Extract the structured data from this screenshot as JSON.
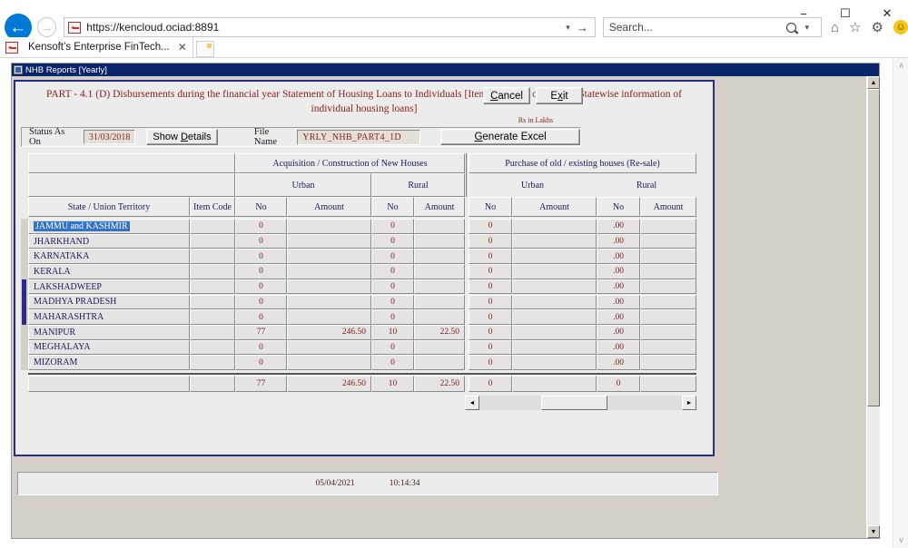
{
  "browser": {
    "url": "https://kencloud.ociad:8891",
    "search_placeholder": "Search...",
    "tab_label": "Kensoft’s Enterprise FinTech...",
    "tab_close": "✕",
    "back_icon": "←",
    "forward_icon": "→",
    "url_dropdown_icon": "▾",
    "url_go_icon": "→",
    "search_dropdown_icon": "▾",
    "home_icon": "⌂",
    "favorites_icon": "☆",
    "settings_icon": "⚙",
    "smiley_icon": "☺",
    "minimize": "−",
    "maximize": "☐",
    "close": "✕",
    "scroll_up_icon": "∧",
    "scroll_down_icon": "∨"
  },
  "window": {
    "title": "NHB Reports [Yearly]",
    "scroll_up_icon": "▲",
    "scroll_down_icon": "▼"
  },
  "report": {
    "title_line1": "PART - 4.1 (D) Disbursements during the financial year Statement of Housing Loans to Individuals [Item Code 411 of",
    "title_line2": "Part-4] [Statewise information of individual housing loans]",
    "cancel_label": "Cancel",
    "exit_label": "Exit",
    "units_note": "Rs in Lakhs"
  },
  "statusbar": {
    "status_label": "Status As On",
    "status_value": "31/03/2018",
    "show_details_label": "Show Details",
    "file_name_label": "File Name",
    "file_name_value": "YRLY_NHB_PART4_1D",
    "generate_excel_label": "Generate Excel"
  },
  "grid": {
    "group_headers": [
      "Acquisition  / Construction of New Houses",
      "Purchase of old / existing houses (Re-sale)"
    ],
    "sub_headers_left": [
      "Urban",
      "Rural"
    ],
    "sub_headers_right": [
      "Urban",
      "Rural"
    ],
    "columns": [
      "State / Union Territory",
      "Item Code",
      "No",
      "Amount",
      "No",
      "Amount",
      "No",
      "Amount",
      "No",
      "Amount"
    ],
    "rows": [
      {
        "state": "JAMMU and KASHMIR",
        "item_code": "",
        "acq_urban_no": "0",
        "acq_urban_amt": "",
        "acq_rural_no": "0",
        "acq_rural_amt": "",
        "res_urban_no": "0",
        "res_urban_amt": "",
        "res_rural_no": ".00",
        "res_rural_amt": "",
        "selected": true
      },
      {
        "state": "JHARKHAND",
        "item_code": "",
        "acq_urban_no": "0",
        "acq_urban_amt": "",
        "acq_rural_no": "0",
        "acq_rural_amt": "",
        "res_urban_no": "0",
        "res_urban_amt": "",
        "res_rural_no": ".00",
        "res_rural_amt": "",
        "selected": false
      },
      {
        "state": "KARNATAKA",
        "item_code": "",
        "acq_urban_no": "0",
        "acq_urban_amt": "",
        "acq_rural_no": "0",
        "acq_rural_amt": "",
        "res_urban_no": "0",
        "res_urban_amt": "",
        "res_rural_no": ".00",
        "res_rural_amt": "",
        "selected": false
      },
      {
        "state": "KERALA",
        "item_code": "",
        "acq_urban_no": "0",
        "acq_urban_amt": "",
        "acq_rural_no": "0",
        "acq_rural_amt": "",
        "res_urban_no": "0",
        "res_urban_amt": "",
        "res_rural_no": ".00",
        "res_rural_amt": "",
        "selected": false
      },
      {
        "state": "LAKSHADWEEP",
        "item_code": "",
        "acq_urban_no": "0",
        "acq_urban_amt": "",
        "acq_rural_no": "0",
        "acq_rural_amt": "",
        "res_urban_no": "0",
        "res_urban_amt": "",
        "res_rural_no": ".00",
        "res_rural_amt": "",
        "selected": false
      },
      {
        "state": "MADHYA PRADESH",
        "item_code": "",
        "acq_urban_no": "0",
        "acq_urban_amt": "",
        "acq_rural_no": "0",
        "acq_rural_amt": "",
        "res_urban_no": "0",
        "res_urban_amt": "",
        "res_rural_no": ".00",
        "res_rural_amt": "",
        "selected": false
      },
      {
        "state": "MAHARASHTRA",
        "item_code": "",
        "acq_urban_no": "0",
        "acq_urban_amt": "",
        "acq_rural_no": "0",
        "acq_rural_amt": "",
        "res_urban_no": "0",
        "res_urban_amt": "",
        "res_rural_no": ".00",
        "res_rural_amt": "",
        "selected": false
      },
      {
        "state": "MANIPUR",
        "item_code": "",
        "acq_urban_no": "77",
        "acq_urban_amt": "246.50",
        "acq_rural_no": "10",
        "acq_rural_amt": "22.50",
        "res_urban_no": "0",
        "res_urban_amt": "",
        "res_rural_no": ".00",
        "res_rural_amt": "",
        "selected": false
      },
      {
        "state": "MEGHALAYA",
        "item_code": "",
        "acq_urban_no": "0",
        "acq_urban_amt": "",
        "acq_rural_no": "0",
        "acq_rural_amt": "",
        "res_urban_no": "0",
        "res_urban_amt": "",
        "res_rural_no": ".00",
        "res_rural_amt": "",
        "selected": false
      },
      {
        "state": "MIZORAM",
        "item_code": "",
        "acq_urban_no": "0",
        "acq_urban_amt": "",
        "acq_rural_no": "0",
        "acq_rural_amt": "",
        "res_urban_no": "0",
        "res_urban_amt": "",
        "res_rural_no": ".00",
        "res_rural_amt": "",
        "selected": false
      }
    ],
    "totals": {
      "state": "",
      "item_code": "",
      "acq_urban_no": "77",
      "acq_urban_amt": "246.50",
      "acq_rural_no": "10",
      "acq_rural_amt": "22.50",
      "res_urban_no": "0",
      "res_urban_amt": "",
      "res_rural_no": "0",
      "res_rural_amt": ""
    },
    "hscroll_left_icon": "◄",
    "hscroll_right_icon": "►"
  },
  "footer": {
    "date": "05/04/2021",
    "time": "10:14:34"
  },
  "colors": {
    "title_bar": "#0a246a",
    "panel_border": "#2a2a8a",
    "report_title": "#8b2020",
    "value_text": "#7a2222",
    "header_text": "#1a1a5e",
    "selection": "#3173c8",
    "window_face": "#d4d0c8"
  }
}
